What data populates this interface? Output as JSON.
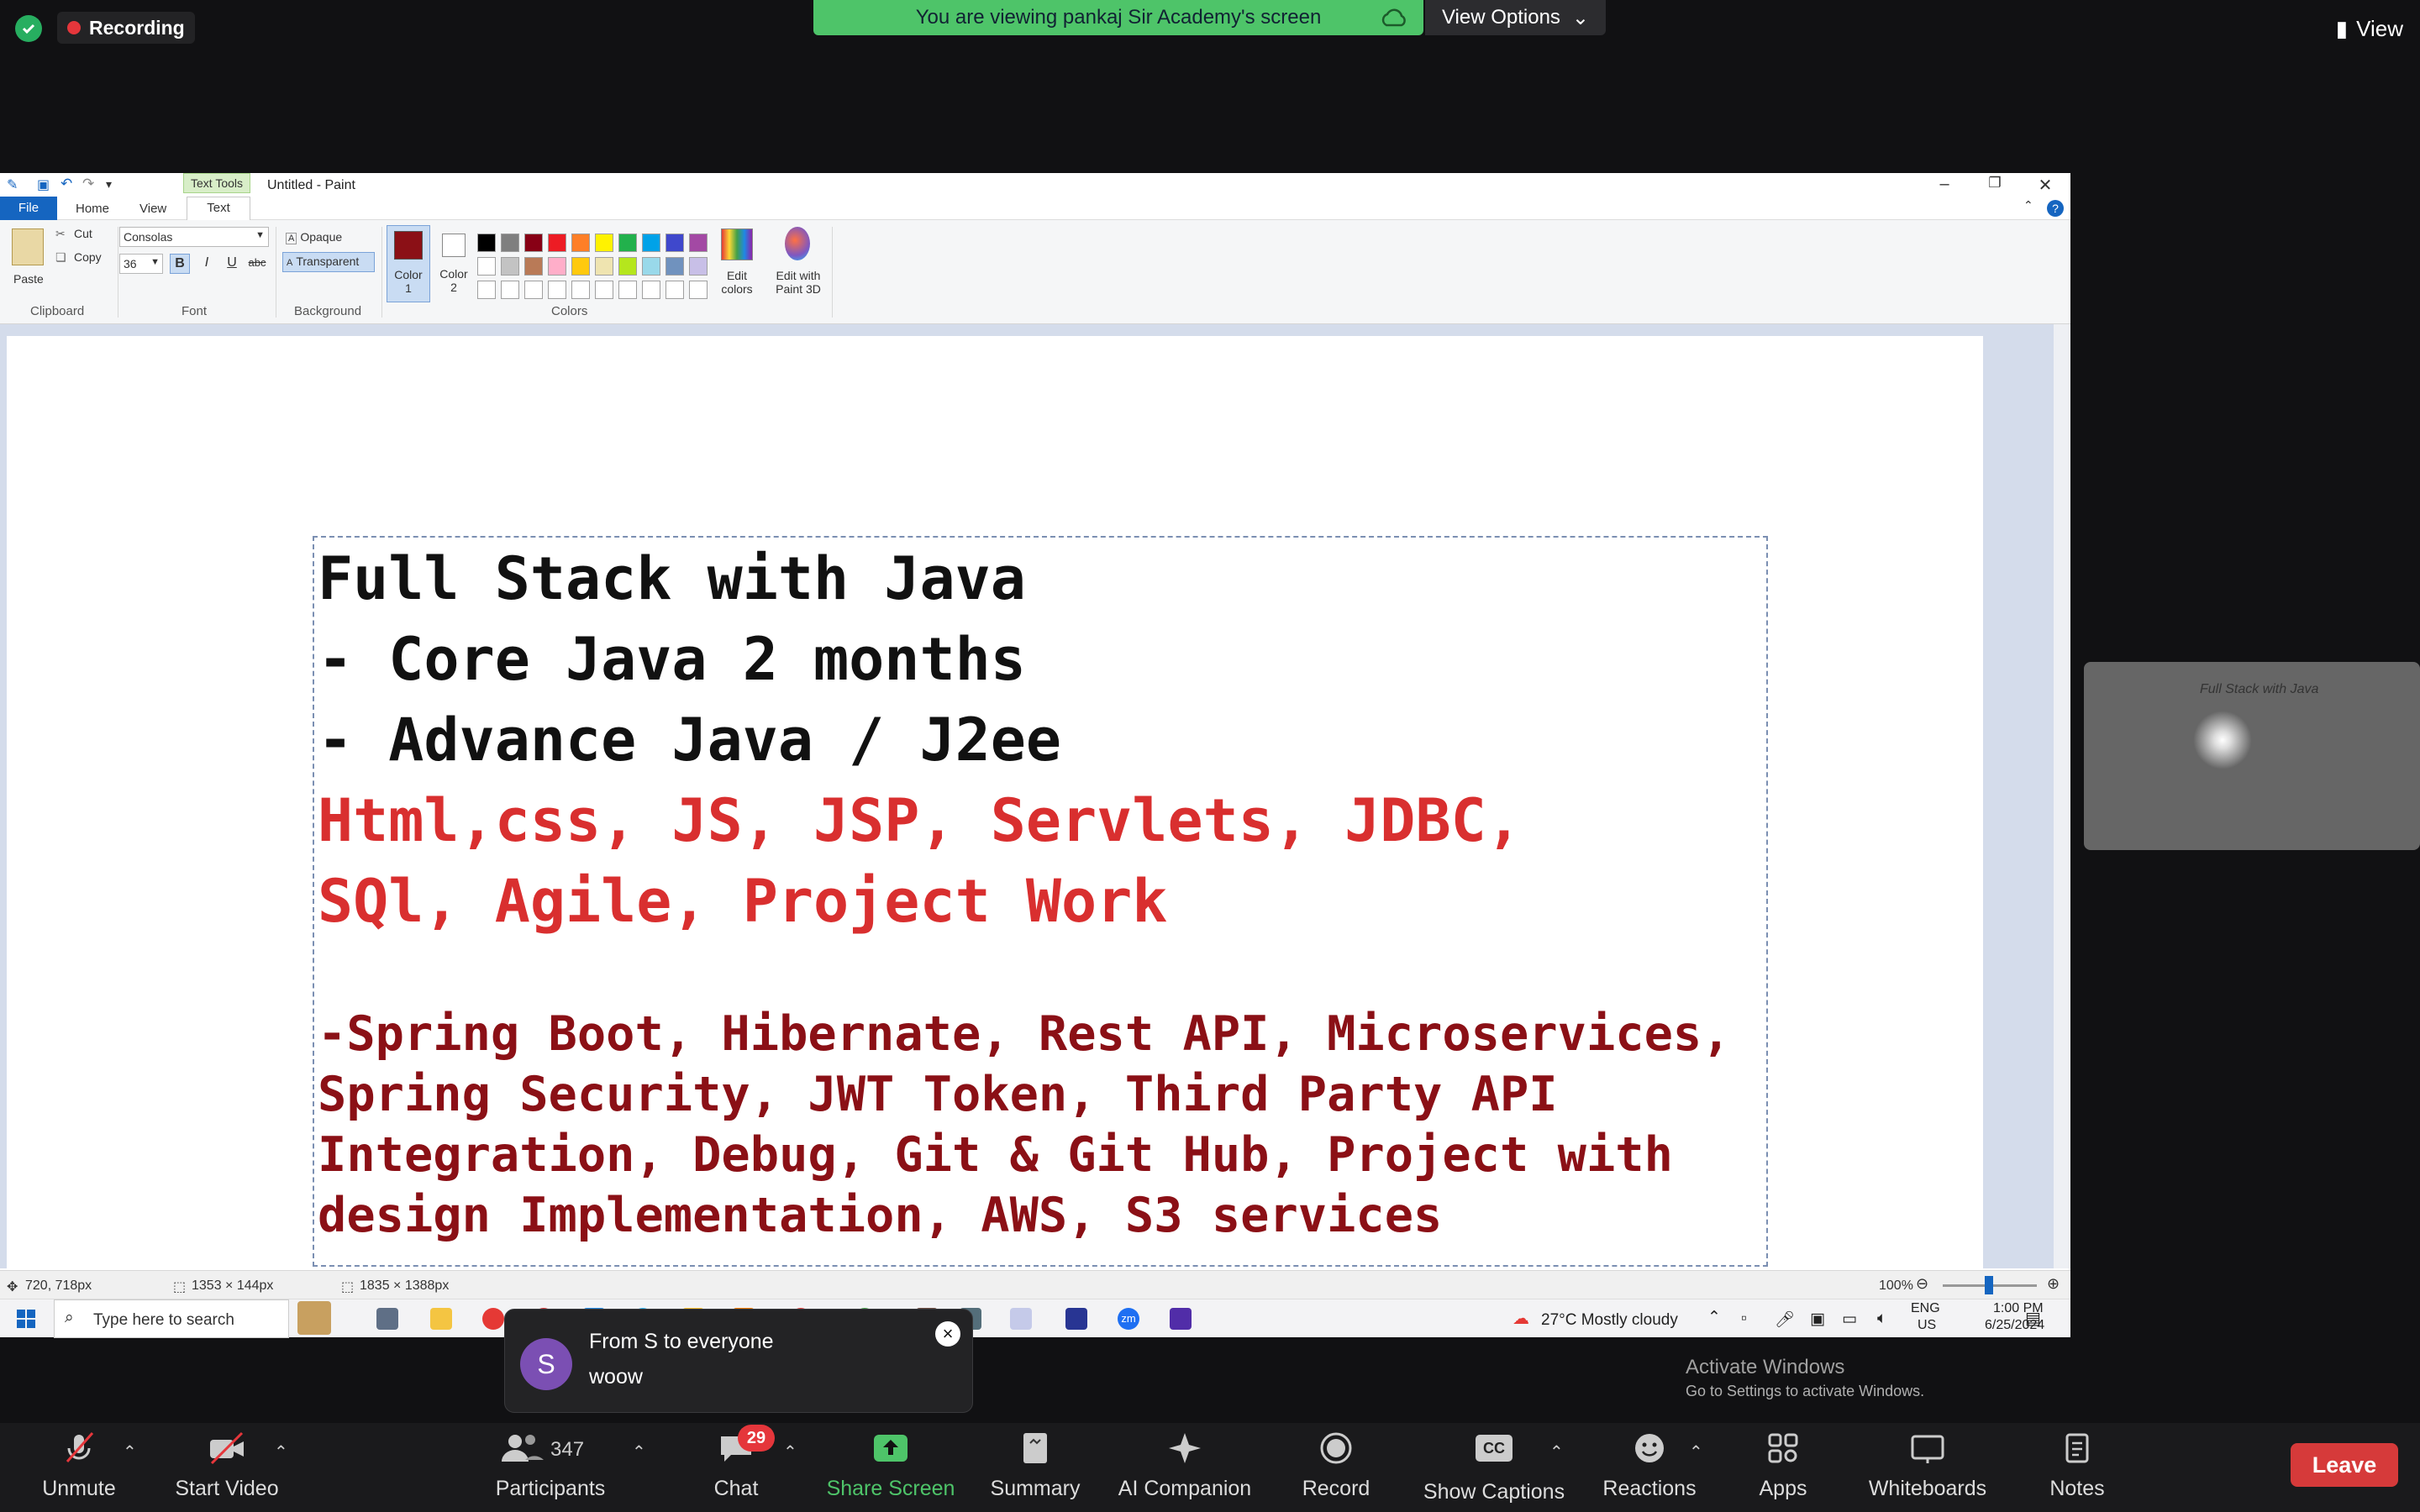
{
  "zoom_top": {
    "recording_label": "Recording",
    "banner_text": "You are viewing pankaj Sir Academy's screen",
    "view_options_label": "View Options",
    "view_label": "View"
  },
  "paint": {
    "title": "Untitled - Paint",
    "text_tools_label": "Text Tools",
    "menu": {
      "file": "File",
      "home": "Home",
      "view": "View",
      "text": "Text"
    },
    "clipboard": {
      "paste": "Paste",
      "cut": "Cut",
      "copy": "Copy",
      "group": "Clipboard"
    },
    "font": {
      "family": "Consolas",
      "size": "36",
      "group": "Font"
    },
    "background": {
      "opaque": "Opaque",
      "transparent": "Transparent",
      "group": "Background"
    },
    "colors": {
      "color1_label": "Color 1",
      "color2_label": "Color 2",
      "group": "Colors",
      "edit_colors": "Edit colors",
      "edit_paint3d": "Edit with Paint 3D",
      "color1": "#8b1016",
      "palette_row1": [
        "#000000",
        "#7f7f7f",
        "#880015",
        "#ed1c24",
        "#ff7f27",
        "#fff200",
        "#22b14c",
        "#00a2e8",
        "#3f48cc",
        "#a349a4"
      ],
      "palette_row2": [
        "#ffffff",
        "#c3c3c3",
        "#b97a57",
        "#ffaec9",
        "#ffc90e",
        "#efe4b0",
        "#b5e61d",
        "#99d9ea",
        "#7092be",
        "#c8bfe7"
      ]
    },
    "canvas_lines": {
      "l1": "Full Stack with Java",
      "l2": "- Core Java 2 months",
      "l3": "- Advance Java / J2ee",
      "l4": "Html,css, JS, JSP, Servlets, JDBC,",
      "l5": "SQl, Agile, Project Work",
      "l6": "-Spring Boot, Hibernate, Rest API, Microservices,",
      "l7": "Spring Security, JWT Token, Third Party API",
      "l8": "Integration, Debug, Git & Git Hub, Project with",
      "l9": "design Implementation, AWS, S3 services"
    },
    "watermark": {
      "title": "Activate Windows",
      "sub": "Go to Settings to activate Windows."
    },
    "status": {
      "pos": "720, 718px",
      "selection": "1353 × 144px",
      "canvas_size": "1835 × 1388px",
      "zoom": "100%"
    }
  },
  "taskbar": {
    "search_placeholder": "Type here to search",
    "weather": "27°C  Mostly cloudy",
    "lang1": "ENG",
    "lang2": "US",
    "time": "1:00 PM",
    "date": "6/25/2024"
  },
  "video": {
    "caption": "Full Stack with Java"
  },
  "toast": {
    "avatar_letter": "S",
    "from": "From S to everyone",
    "message": "woow"
  },
  "bottom": {
    "unmute": "Unmute",
    "start_video": "Start Video",
    "participants": "Participants",
    "participants_count": "347",
    "chat": "Chat",
    "chat_badge": "29",
    "share": "Share Screen",
    "summary": "Summary",
    "ai": "AI Companion",
    "record": "Record",
    "captions": "Show Captions",
    "captions_icon": "CC",
    "reactions": "Reactions",
    "apps": "Apps",
    "whiteboards": "Whiteboards",
    "notes": "Notes",
    "leave": "Leave",
    "accent_green": "#4ec469",
    "leave_red": "#d63a3a"
  }
}
